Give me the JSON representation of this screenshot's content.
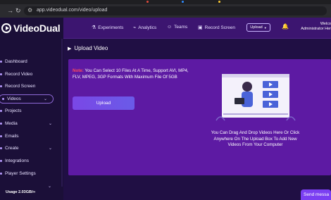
{
  "browser": {
    "url": "app.videodual.com/video/upload",
    "back_icon": "arrow-left-icon",
    "forward_icon": "arrow-right-icon",
    "reload_icon": "reload-icon",
    "site_settings_icon": "tune-icon"
  },
  "brand": {
    "name": "VideoDual"
  },
  "header": {
    "nav": [
      {
        "label": "Experiments",
        "icon": "flask-icon"
      },
      {
        "label": "Analytics",
        "icon": "chart-icon"
      },
      {
        "label": "Teams",
        "icon": "users-icon"
      },
      {
        "label": "Record Screen",
        "icon": "record-icon"
      }
    ],
    "upload_dropdown": "Upload",
    "welcome_line1": "Welco",
    "welcome_line2": "Administrator Her"
  },
  "sidebar": {
    "items": [
      {
        "label": "Dashboard",
        "has_chevron": false
      },
      {
        "label": "Record Video",
        "has_chevron": false
      },
      {
        "label": "Record Screen",
        "has_chevron": false
      },
      {
        "label": "Videos",
        "has_chevron": true,
        "active": true
      },
      {
        "label": "Projects",
        "has_chevron": false
      },
      {
        "label": "Media",
        "has_chevron": true
      },
      {
        "label": "Emails",
        "has_chevron": false
      },
      {
        "label": "Create",
        "has_chevron": true
      },
      {
        "label": "Integrations",
        "has_chevron": false
      },
      {
        "label": "Player Settings",
        "has_chevron": false
      }
    ],
    "usage": "Usage 2.03GB/∞"
  },
  "main": {
    "title": "Upload Video",
    "note_label": "Note:",
    "note_text": " You Can Select 10 Files At A Time, Support AVI, MP4, FLV, MPEG, 3GP Formats With Maximum File Of 5GB",
    "upload_button": "Upload",
    "drop_text": "You Can Drag And Drop Videos Here Or Click Anywhere On The Upload Box To Add New Videos From Your Computer"
  },
  "chat": {
    "label": "Send messa"
  },
  "colors": {
    "header_bg": "#3c1570",
    "card_bg": "#5d1aa3",
    "accent": "#7a47e6",
    "note_red": "#ff4a5a"
  }
}
